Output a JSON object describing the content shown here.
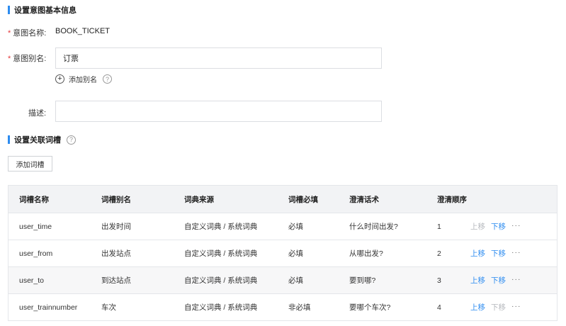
{
  "basic_section": {
    "title": "设置意图基本信息"
  },
  "form": {
    "name_label": "意图名称:",
    "name_value": "BOOK_TICKET",
    "alias_label": "意图别名:",
    "alias_value": "订票",
    "add_alias_label": "添加别名",
    "description_label": "描述:",
    "description_value": "",
    "required_mark": "*"
  },
  "slot_section": {
    "title": "设置关联词槽",
    "add_button_label": "添加词槽"
  },
  "help_glyph": "?",
  "plus_glyph": "+",
  "table": {
    "columns": [
      "词槽名称",
      "词槽别名",
      "词典来源",
      "词槽必填",
      "澄清话术",
      "澄清顺序",
      ""
    ],
    "rows": [
      {
        "name": "user_time",
        "alias": "出发时间",
        "source": "自定义词典 / 系统词典",
        "required": "必填",
        "clarify": "什么时间出发?",
        "order": "1",
        "up": "上移",
        "up_enabled": false,
        "down": "下移",
        "down_enabled": true,
        "more": "···"
      },
      {
        "name": "user_from",
        "alias": "出发站点",
        "source": "自定义词典 / 系统词典",
        "required": "必填",
        "clarify": "从哪出发?",
        "order": "2",
        "up": "上移",
        "up_enabled": true,
        "down": "下移",
        "down_enabled": true,
        "more": "···"
      },
      {
        "name": "user_to",
        "alias": "到达站点",
        "source": "自定义词典 / 系统词典",
        "required": "必填",
        "clarify": "要到哪?",
        "order": "3",
        "up": "上移",
        "up_enabled": true,
        "down": "下移",
        "down_enabled": true,
        "more": "···"
      },
      {
        "name": "user_trainnumber",
        "alias": "车次",
        "source": "自定义词典 / 系统词典",
        "required": "非必填",
        "clarify": "要哪个车次?",
        "order": "4",
        "up": "上移",
        "up_enabled": true,
        "down": "下移",
        "down_enabled": false,
        "more": "···"
      }
    ]
  }
}
